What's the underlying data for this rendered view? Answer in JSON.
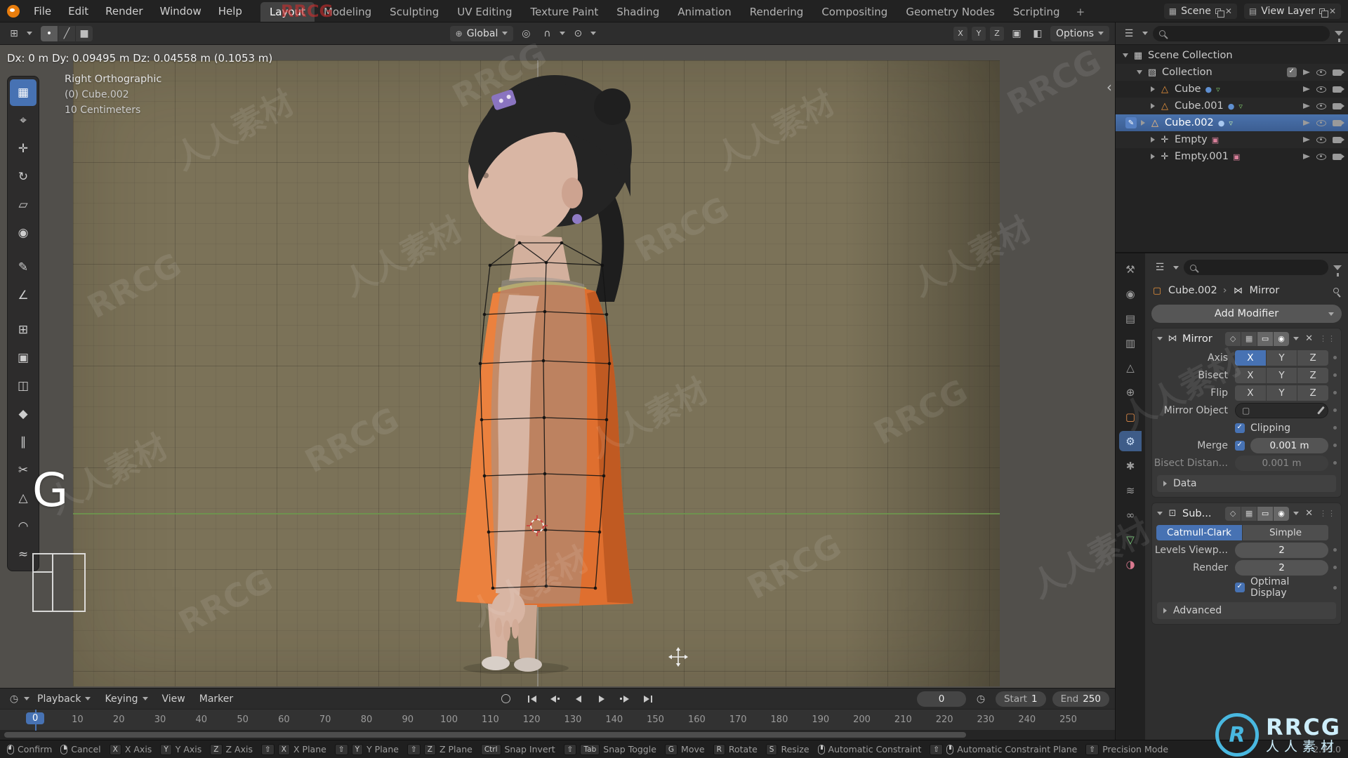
{
  "topbar": {
    "menus": [
      "File",
      "Edit",
      "Render",
      "Window",
      "Help"
    ],
    "workspaces": [
      "Layout",
      "Modeling",
      "Sculpting",
      "UV Editing",
      "Texture Paint",
      "Shading",
      "Animation",
      "Rendering",
      "Compositing",
      "Geometry Nodes",
      "Scripting"
    ],
    "add_tab": "+",
    "active_workspace": "Layout",
    "scene_label": "Scene",
    "view_layer_label": "View Layer"
  },
  "tool_header": {
    "orientation": "Global",
    "options": "Options",
    "x": "X",
    "y": "Y",
    "z": "Z"
  },
  "viewport": {
    "readout": "Dx: 0 m  Dy: 0.09495 m  Dz: 0.04558 m (0.1053 m)",
    "view_name": "Right Orthographic",
    "active_object": "(0) Cube.002",
    "grid_scale": "10 Centimeters",
    "hotkey": "G"
  },
  "outliner": {
    "rows": [
      {
        "label": "Scene Collection"
      },
      {
        "label": "Collection"
      },
      {
        "label": "Cube"
      },
      {
        "label": "Cube.001"
      },
      {
        "label": "Cube.002"
      },
      {
        "label": "Empty"
      },
      {
        "label": "Empty.001"
      }
    ]
  },
  "properties": {
    "object_name": "Cube.002",
    "modifier_breadcrumb": "Mirror",
    "add_modifier": "Add Modifier",
    "mirror": {
      "name": "Mirror",
      "axis_label": "Axis",
      "bisect_label": "Bisect",
      "flip_label": "Flip",
      "x": "X",
      "y": "Y",
      "z": "Z",
      "mirror_object_label": "Mirror Object",
      "clipping_label": "Clipping",
      "merge_label": "Merge",
      "merge_value": "0.001 m",
      "bisect_distance_label": "Bisect Distan...",
      "bisect_distance_value": "0.001 m",
      "data_section": "Data"
    },
    "subdiv": {
      "name": "Sub...",
      "catmull_clark": "Catmull-Clark",
      "simple": "Simple",
      "levels_label": "Levels Viewp...",
      "levels_value": "2",
      "render_label": "Render",
      "render_value": "2",
      "optimal_display_label": "Optimal Display",
      "advanced_section": "Advanced"
    }
  },
  "timeline": {
    "menus": [
      "Playback",
      "Keying",
      "View",
      "Marker"
    ],
    "current_frame": "0",
    "start_label": "Start",
    "start_value": "1",
    "end_label": "End",
    "end_value": "250",
    "ticks": [
      "10",
      "20",
      "30",
      "40",
      "50",
      "60",
      "70",
      "80",
      "90",
      "100",
      "110",
      "120",
      "130",
      "140",
      "150",
      "160",
      "170",
      "180",
      "190",
      "200",
      "210",
      "220",
      "230",
      "240",
      "250"
    ]
  },
  "statusbar": {
    "hints": [
      {
        "keys": [
          "LMB"
        ],
        "label": "Confirm"
      },
      {
        "keys": [
          "RMB"
        ],
        "label": "Cancel"
      },
      {
        "keys": [
          "X"
        ],
        "label": "X Axis"
      },
      {
        "keys": [
          "Y"
        ],
        "label": "Y Axis"
      },
      {
        "keys": [
          "Z"
        ],
        "label": "Z Axis"
      },
      {
        "keys": [
          "⇧",
          "X"
        ],
        "label": "X Plane"
      },
      {
        "keys": [
          "⇧",
          "Y"
        ],
        "label": "Y Plane"
      },
      {
        "keys": [
          "⇧",
          "Z"
        ],
        "label": "Z Plane"
      },
      {
        "keys": [
          "Ctrl"
        ],
        "label": "Snap Invert"
      },
      {
        "keys": [
          "⇧",
          "Tab"
        ],
        "label": "Snap Toggle"
      },
      {
        "keys": [
          "G"
        ],
        "label": "Move"
      },
      {
        "keys": [
          "R"
        ],
        "label": "Rotate"
      },
      {
        "keys": [
          "S"
        ],
        "label": "Resize"
      },
      {
        "keys": [
          "MMB"
        ],
        "label": "Automatic Constraint"
      },
      {
        "keys": [
          "⇧",
          "MMB"
        ],
        "label": "Automatic Constraint Plane"
      },
      {
        "keys": [
          "⇧"
        ],
        "label": "Precision Mode"
      }
    ],
    "version": "2.93.0"
  },
  "watermark": {
    "brand": "RRCG",
    "brand_cn": "人人素材"
  },
  "colors": {
    "accent_blue": "#4772b3",
    "viewport_olive": "#7b7258",
    "dress_orange": "#df6f2f"
  }
}
